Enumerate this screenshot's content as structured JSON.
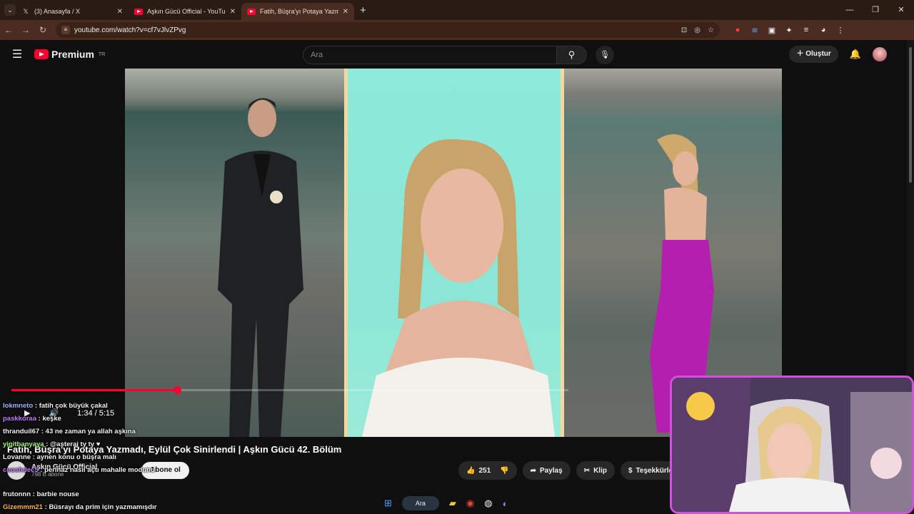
{
  "browser": {
    "tabs": [
      {
        "title": "(3) Anasayfa / X",
        "icon": "x-logo-icon",
        "active": false
      },
      {
        "title": "Aşkın Gücü Official - YouTube",
        "icon": "youtube-icon",
        "active": false
      },
      {
        "title": "Fatih, Büşra'yı Potaya Yazm...",
        "icon": "youtube-icon",
        "active": true
      }
    ],
    "url": "youtube.com/watch?v=cf7vJlvZPvg"
  },
  "youtube": {
    "logo_text": "Premium",
    "region": "TR",
    "search_placeholder": "Ara",
    "create_label": "Oluştur"
  },
  "player": {
    "time": "1:34 / 5:15",
    "progress": 0.298
  },
  "video": {
    "title": "Fatih, Büşra'yı Potaya Yazmadı, Eylül Çok Sinirlendi | Aşkın Gücü 42. Bölüm",
    "channel": "Aşkın Gücü Official",
    "subscribers": "798 B abone",
    "subscribe_label": "Abone ol",
    "likes": "251",
    "share_label": "Paylaş",
    "clip_label": "Klip",
    "thanks_label": "Teşekkürler"
  },
  "chat": [
    {
      "user": "lokmneto",
      "text": "fatih çok büyük çakal",
      "color": "#9fb4ff"
    },
    {
      "user": "paskkoraa",
      "text": "keşke",
      "color": "#c27bff"
    },
    {
      "user": "thranduil67",
      "text": "43 ne zaman ya allah aşkına",
      "color": "#f0f0f0"
    },
    {
      "user": "yigitbanyaya",
      "text": "@asterai ty ty ♥",
      "color": "#9dff6a"
    },
    {
      "user": "Lovanne",
      "text": "aynen konu o büşra malı",
      "color": "#f0f0f0"
    },
    {
      "user": "cuoshdec5",
      "text": "perinaz nasıl açtı mahalle modunu",
      "color": "#c27bff"
    },
    {
      "user": "frutonnn",
      "text": "barbie nouse",
      "color": "#f0f0f0"
    },
    {
      "user": "Gizemmm21",
      "text": "Büsrayı da prim için yazmamışdır",
      "color": "#ffb347"
    }
  ],
  "taskbar": {
    "search_label": "Ara"
  }
}
